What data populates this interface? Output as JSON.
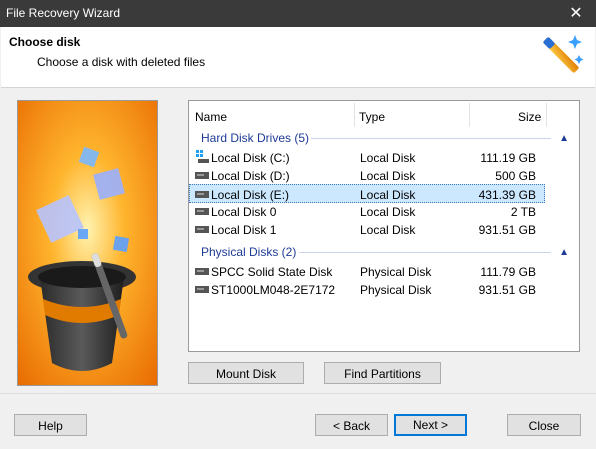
{
  "window": {
    "title": "File Recovery Wizard",
    "close_glyph": "✕"
  },
  "header": {
    "title": "Choose disk",
    "subtitle": "Choose a disk with deleted files",
    "icon": "magic-wand-icon"
  },
  "list": {
    "columns": {
      "name": "Name",
      "type": "Type",
      "size": "Size"
    },
    "groups": [
      {
        "label": "Hard Disk Drives (5)",
        "items": [
          {
            "name": "Local Disk (C:)",
            "type": "Local Disk",
            "size": "111.19 GB",
            "icon": "windows-drive-icon",
            "selected": false
          },
          {
            "name": "Local Disk (D:)",
            "type": "Local Disk",
            "size": "500 GB",
            "icon": "drive-icon",
            "selected": false
          },
          {
            "name": "Local Disk (E:)",
            "type": "Local Disk",
            "size": "431.39 GB",
            "icon": "drive-icon",
            "selected": true
          },
          {
            "name": "Local Disk 0",
            "type": "Local Disk",
            "size": "2 TB",
            "icon": "drive-icon",
            "selected": false
          },
          {
            "name": "Local Disk 1",
            "type": "Local Disk",
            "size": "931.51 GB",
            "icon": "drive-icon",
            "selected": false
          }
        ]
      },
      {
        "label": "Physical Disks (2)",
        "items": [
          {
            "name": "SPCC Solid State Disk",
            "type": "Physical Disk",
            "size": "111.79 GB",
            "icon": "drive-icon",
            "selected": false
          },
          {
            "name": "ST1000LM048-2E7172",
            "type": "Physical Disk",
            "size": "931.51 GB",
            "icon": "drive-icon",
            "selected": false
          }
        ]
      }
    ]
  },
  "buttons": {
    "mount": "Mount Disk",
    "find": "Find Partitions",
    "help": "Help",
    "back": "< Back",
    "next": "Next >",
    "close": "Close"
  },
  "colors": {
    "group_text": "#1e3a96",
    "selection": "#cce8ff",
    "accent": "#0078d7",
    "art_orange": "#ff8c00"
  }
}
